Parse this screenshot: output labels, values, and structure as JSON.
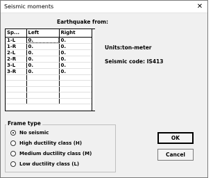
{
  "window": {
    "title": "Seismic moments",
    "close_glyph": "✕"
  },
  "earthquake_label": "Earthquake from:",
  "table": {
    "headers": [
      "Sp...",
      "Left",
      "Right"
    ],
    "rows": [
      [
        "1-L",
        "0.",
        "0."
      ],
      [
        "1-R",
        "0.",
        "0."
      ],
      [
        "2-L",
        "0.",
        "0."
      ],
      [
        "2-R",
        "0.",
        "0."
      ],
      [
        "3-L",
        "0.",
        "0."
      ],
      [
        "3-R",
        "0.",
        "0."
      ],
      [
        "",
        "",
        ""
      ],
      [
        "",
        "",
        ""
      ],
      [
        "",
        "",
        ""
      ],
      [
        "",
        "",
        ""
      ],
      [
        "",
        "",
        ""
      ]
    ]
  },
  "units": "Units:ton-meter",
  "seismic_code": "Seismic code: IS413",
  "frame_type": {
    "legend": "Frame type",
    "selected_index": 0,
    "options": [
      "No seismic",
      "High ductility class (H)",
      "Medium ductility class (M)",
      "Low ductility class (L)"
    ]
  },
  "buttons": {
    "ok": "OK",
    "cancel": "Cancel"
  }
}
